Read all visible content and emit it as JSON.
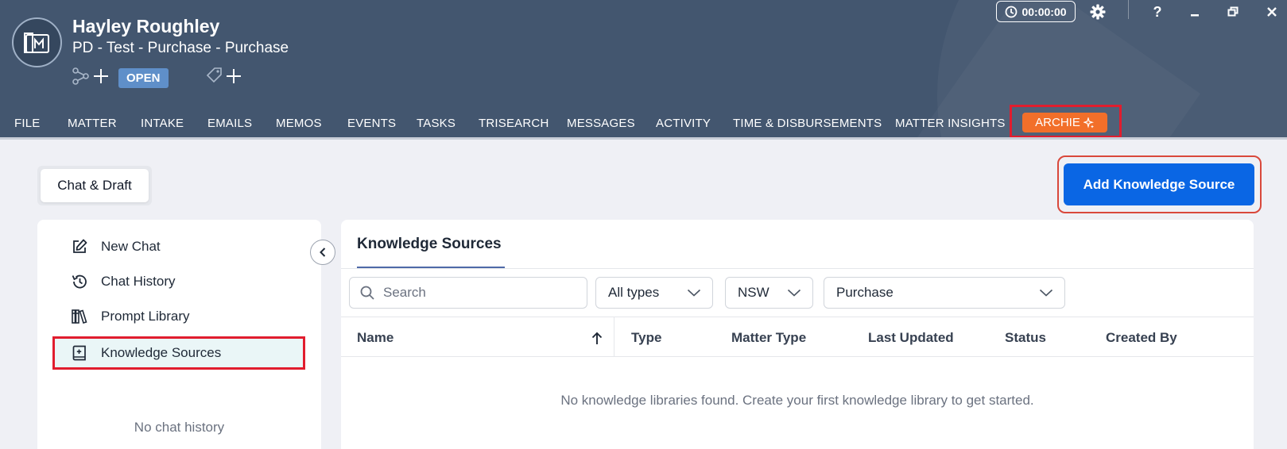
{
  "header": {
    "client_name": "Hayley Roughley",
    "matter_name": "PD - Test - Purchase - Purchase",
    "status": "OPEN",
    "timer": "00:00:00",
    "help_label": "?"
  },
  "tabs": [
    {
      "label": "FILE"
    },
    {
      "label": "MATTER"
    },
    {
      "label": "INTAKE"
    },
    {
      "label": "EMAILS"
    },
    {
      "label": "MEMOS"
    },
    {
      "label": "EVENTS"
    },
    {
      "label": "TASKS"
    },
    {
      "label": "TRISEARCH"
    },
    {
      "label": "MESSAGES"
    },
    {
      "label": "ACTIVITY"
    },
    {
      "label": "TIME & DISBURSEMENTS"
    },
    {
      "label": "MATTER INSIGHTS"
    },
    {
      "label": "ARCHIE"
    }
  ],
  "toolbar": {
    "chat_draft_label": "Chat & Draft",
    "add_knowledge_source_label": "Add Knowledge Source"
  },
  "sidebar": {
    "items": [
      {
        "label": "New Chat"
      },
      {
        "label": "Chat History"
      },
      {
        "label": "Prompt Library"
      },
      {
        "label": "Knowledge Sources"
      }
    ],
    "empty_text": "No chat history"
  },
  "main": {
    "title": "Knowledge Sources",
    "search": {
      "placeholder": "Search"
    },
    "filters": {
      "type": "All types",
      "state": "NSW",
      "matter_type": "Purchase"
    },
    "columns": [
      "Name",
      "Type",
      "Matter Type",
      "Last Updated",
      "Status",
      "Created By"
    ],
    "empty_message": "No knowledge libraries found. Create your first knowledge library to get started."
  },
  "colors": {
    "header_bg": "#43566f",
    "accent_blue": "#0a66e4",
    "archie_orange": "#f26f2a",
    "highlight_red": "#e11d2e"
  }
}
